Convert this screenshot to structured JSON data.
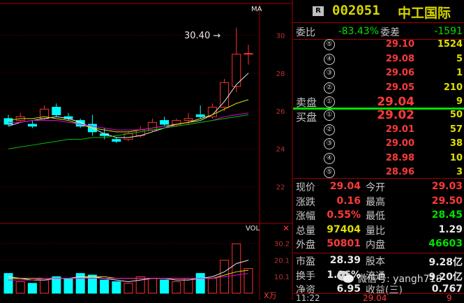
{
  "header": {
    "badge": "R",
    "stock_code": "002051",
    "stock_name": "中工国际",
    "ma_label": "MA",
    "vol_label": "VOL",
    "vol_unit": "X万"
  },
  "chart_data": {
    "type": "candlestick",
    "price_axis": {
      "ticks": [
        "30",
        "28",
        "26",
        "24",
        "22"
      ],
      "ylim": [
        20.8,
        31.2
      ]
    },
    "high_annotation": "30.40",
    "vol_axis": {
      "ticks": [
        "30.2",
        "20.1",
        "10.1"
      ],
      "ylim": [
        0,
        36
      ]
    },
    "candles": [
      {
        "o": 25.6,
        "h": 25.8,
        "l": 25.2,
        "c": 25.3,
        "v": 12
      },
      {
        "o": 25.5,
        "h": 25.9,
        "l": 25.4,
        "c": 25.7,
        "v": 7
      },
      {
        "o": 25.3,
        "h": 25.5,
        "l": 25.1,
        "c": 25.2,
        "v": 6
      },
      {
        "o": 25.6,
        "h": 26.3,
        "l": 25.5,
        "c": 26.1,
        "v": 8
      },
      {
        "o": 26.2,
        "h": 26.4,
        "l": 25.7,
        "c": 25.8,
        "v": 10
      },
      {
        "o": 25.7,
        "h": 25.9,
        "l": 25.5,
        "c": 25.6,
        "v": 9
      },
      {
        "o": 25.5,
        "h": 25.6,
        "l": 25.1,
        "c": 25.2,
        "v": 12
      },
      {
        "o": 25.3,
        "h": 25.8,
        "l": 24.7,
        "c": 24.9,
        "v": 11
      },
      {
        "o": 24.8,
        "h": 25.1,
        "l": 24.5,
        "c": 24.7,
        "v": 8
      },
      {
        "o": 24.5,
        "h": 24.6,
        "l": 24.3,
        "c": 24.4,
        "v": 7
      },
      {
        "o": 24.5,
        "h": 24.9,
        "l": 24.4,
        "c": 24.8,
        "v": 6
      },
      {
        "o": 24.7,
        "h": 25.2,
        "l": 24.6,
        "c": 25.0,
        "v": 10
      },
      {
        "o": 25.0,
        "h": 25.6,
        "l": 24.9,
        "c": 25.4,
        "v": 9
      },
      {
        "o": 25.5,
        "h": 25.7,
        "l": 25.2,
        "c": 25.3,
        "v": 8
      },
      {
        "o": 25.3,
        "h": 25.6,
        "l": 25.2,
        "c": 25.5,
        "v": 7
      },
      {
        "o": 25.5,
        "h": 25.9,
        "l": 25.3,
        "c": 25.6,
        "v": 9
      },
      {
        "o": 25.8,
        "h": 26.3,
        "l": 25.6,
        "c": 25.7,
        "v": 12
      },
      {
        "o": 25.7,
        "h": 26.4,
        "l": 25.6,
        "c": 26.2,
        "v": 9
      },
      {
        "o": 26.2,
        "h": 27.7,
        "l": 26.0,
        "c": 27.5,
        "v": 20
      },
      {
        "o": 27.3,
        "h": 30.4,
        "l": 27.0,
        "c": 29.0,
        "v": 30
      },
      {
        "o": 29.0,
        "h": 29.5,
        "l": 28.45,
        "c": 29.04,
        "v": 15
      }
    ],
    "ma_series": [
      {
        "color": "#e8e8e8",
        "values": [
          25.2,
          25.4,
          25.5,
          25.6,
          25.7,
          25.6,
          25.4,
          25.1,
          24.8,
          24.6,
          24.6,
          24.7,
          24.9,
          25.1,
          25.3,
          25.4,
          25.5,
          25.8,
          26.5,
          27.4,
          28.0
        ]
      },
      {
        "color": "#e0e000",
        "values": [
          25.5,
          25.6,
          25.6,
          25.7,
          25.6,
          25.5,
          25.3,
          25.1,
          25.0,
          24.9,
          24.9,
          25.0,
          25.1,
          25.2,
          25.3,
          25.4,
          25.6,
          25.8,
          26.1,
          26.4,
          26.6
        ]
      },
      {
        "color": "#e000e0",
        "values": [
          25.4,
          25.4,
          25.5,
          25.5,
          25.5,
          25.4,
          25.3,
          25.2,
          25.1,
          25.0,
          25.0,
          25.0,
          25.1,
          25.2,
          25.2,
          25.3,
          25.4,
          25.5,
          25.7,
          25.8,
          25.9
        ]
      },
      {
        "color": "#00c000",
        "values": [
          24.0,
          24.1,
          24.2,
          24.3,
          24.4,
          24.5,
          24.5,
          24.6,
          24.6,
          24.7,
          24.8,
          24.9,
          25.0,
          25.1,
          25.2,
          25.3,
          25.4,
          25.5,
          25.6,
          25.7,
          25.8
        ]
      }
    ],
    "vol_ma_series": [
      {
        "color": "#e8e8e8",
        "values": [
          10,
          9,
          8,
          8,
          9,
          9,
          10,
          10,
          9,
          8,
          7,
          8,
          9,
          9,
          8,
          8,
          9,
          10,
          13,
          18,
          20
        ]
      },
      {
        "color": "#e0e000",
        "values": [
          9,
          9,
          9,
          9,
          9,
          9,
          9,
          10,
          10,
          9,
          9,
          9,
          9,
          9,
          9,
          9,
          9,
          9,
          11,
          13,
          14
        ]
      },
      {
        "color": "#e000e0",
        "values": [
          8,
          8,
          8,
          9,
          9,
          9,
          9,
          9,
          9,
          9,
          9,
          9,
          9,
          9,
          9,
          9,
          9,
          9,
          10,
          11,
          12
        ]
      }
    ]
  },
  "quote": {
    "weibi_label": "委比",
    "weibi_value": "-83.43%",
    "weicha_label": "委差",
    "weicha_value": "-1591",
    "sell_label": "卖盘",
    "buy_label": "买盘",
    "sell_orders": [
      {
        "n": "⑤",
        "price": "29.10",
        "vol": "1524"
      },
      {
        "n": "④",
        "price": "29.08",
        "vol": "5"
      },
      {
        "n": "③",
        "price": "29.06",
        "vol": "1"
      },
      {
        "n": "②",
        "price": "29.05",
        "vol": "210"
      },
      {
        "n": "①",
        "price": "29.04",
        "vol": "9"
      }
    ],
    "buy_orders": [
      {
        "n": "①",
        "price": "29.02",
        "vol": "50"
      },
      {
        "n": "②",
        "price": "29.01",
        "vol": "57"
      },
      {
        "n": "③",
        "price": "29.00",
        "vol": "38"
      },
      {
        "n": "④",
        "price": "28.98",
        "vol": "10"
      },
      {
        "n": "⑤",
        "price": "28.96",
        "vol": "3"
      }
    ],
    "stats": [
      {
        "l1": "现价",
        "v1": "29.04",
        "l2": "今开",
        "v2": "29.03"
      },
      {
        "l1": "涨跌",
        "v1": "0.16",
        "l2": "最高",
        "v2": "29.50"
      },
      {
        "l1": "涨幅",
        "v1": "0.55%",
        "l2": "最低",
        "v2": "28.45"
      },
      {
        "l1": "总量",
        "v1": "97404",
        "l2": "量比",
        "v2": "1.29"
      },
      {
        "l1": "外盘",
        "v1": "50801",
        "l2": "内盘",
        "v2": "46603"
      }
    ],
    "fund": [
      {
        "l1": "市盈",
        "v1": "28.39",
        "l2": "股本",
        "v2": "9.28亿"
      },
      {
        "l1": "换手",
        "v1": "1.06%",
        "l2": "流通",
        "v2": "9.20亿"
      },
      {
        "l1": "净资",
        "v1": "6.95",
        "l2": "收益(三)",
        "v2": "0.767"
      }
    ],
    "time": "11:22",
    "tick_price": "29.04",
    "tick_vol": "9"
  },
  "watermark": "微信号: yangh718"
}
